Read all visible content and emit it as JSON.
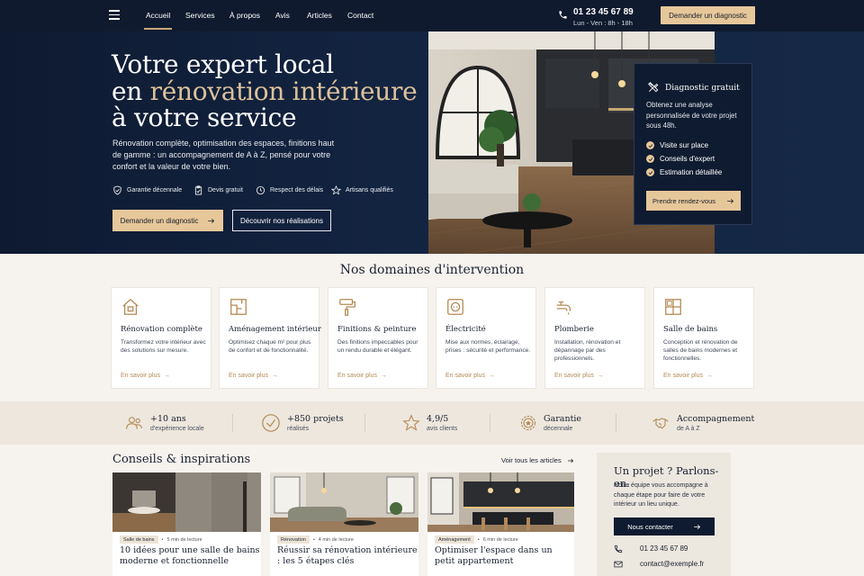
{
  "nav": {
    "links": [
      "Accueil",
      "Services",
      "À propos",
      "Avis",
      "Articles",
      "Contact"
    ],
    "phone": "01 23 45 67 89",
    "hours": "Lun - Ven : 8h - 18h",
    "cta": "Demander un diagnostic"
  },
  "hero": {
    "title_line1": "Votre expert local",
    "title_line2a": "en ",
    "title_line2b": "rénovation intérieure",
    "title_line3": "à votre service",
    "description": "Rénovation complète, optimisation des espaces, finitions haut de gamme : un accompagnement de A à Z, pensé pour votre confort et la valeur de votre bien.",
    "features": [
      "Garantie décennale",
      "Devis gratuit",
      "Respect des délais",
      "Artisans qualifiés"
    ],
    "btn_primary": "Demander un diagnostic",
    "btn_secondary": "Découvrir nos réalisations"
  },
  "diagnostic": {
    "title": "Diagnostic gratuit",
    "text": "Obtenez une analyse personnalisée de votre projet sous 48h.",
    "items": [
      "Visite sur place",
      "Conseils d'expert",
      "Estimation détaillée"
    ],
    "button": "Prendre rendez-vous"
  },
  "domains": {
    "title": "Nos domaines d'intervention",
    "link_label": "En savoir plus",
    "cards": [
      {
        "title": "Rénovation complète",
        "desc": "Transformez votre intérieur avec des solutions sur mesure.",
        "icon": "house-icon"
      },
      {
        "title": "Aménagement intérieur",
        "desc": "Optimisez chaque m² pour plus de confort et de fonctionnalité.",
        "icon": "floorplan-icon"
      },
      {
        "title": "Finitions & peinture",
        "desc": "Des finitions impeccables pour un rendu durable et élégant.",
        "icon": "paint-roller-icon"
      },
      {
        "title": "Électricité",
        "desc": "Mise aux normes, éclairage, prises : sécurité et performance.",
        "icon": "outlet-icon"
      },
      {
        "title": "Plomberie",
        "desc": "Installation, rénovation et dépannage par des professionnels.",
        "icon": "faucet-icon"
      },
      {
        "title": "Salle de bains",
        "desc": "Conception et rénovation de salles de bains modernes et fonctionnelles.",
        "icon": "bathroom-icon"
      }
    ]
  },
  "stats": [
    {
      "value": "+10 ans",
      "label": "d'expérience locale",
      "icon": "people-icon"
    },
    {
      "value": "+850 projets",
      "label": "réalisés",
      "icon": "check-circle-icon"
    },
    {
      "value": "4,9/5",
      "label": "avis clients",
      "icon": "star-icon"
    },
    {
      "value": "Garantie",
      "label": "décennale",
      "icon": "medal-icon"
    },
    {
      "value": "Accompagnement",
      "label": "de A à Z",
      "icon": "handshake-icon"
    }
  ],
  "articles": {
    "title": "Conseils & inspirations",
    "see_all": "Voir tous les articles",
    "items": [
      {
        "tag": "Salle de bains",
        "read": "5 min de lecture",
        "title": "10 idées pour une salle de bains moderne et fonctionnelle"
      },
      {
        "tag": "Rénovation",
        "read": "4 min de lecture",
        "title": "Réussir sa rénovation intérieure : les 5 étapes clés"
      },
      {
        "tag": "Aménagement",
        "read": "6 min de lecture",
        "title": "Optimiser l'espace dans un petit appartement"
      }
    ]
  },
  "contact": {
    "title": "Un projet ? Parlons-en.",
    "desc": "Notre équipe vous accompagne à chaque étape pour faire de votre intérieur un lieu unique.",
    "button": "Nous contacter",
    "phone": "01 23 45 67 89",
    "email": "contact@exemple.fr"
  },
  "colors": {
    "navy": "#0f1a2e",
    "gold": "#e6c79a",
    "accent_text": "#b48a55",
    "cream": "#f6f3ee"
  }
}
